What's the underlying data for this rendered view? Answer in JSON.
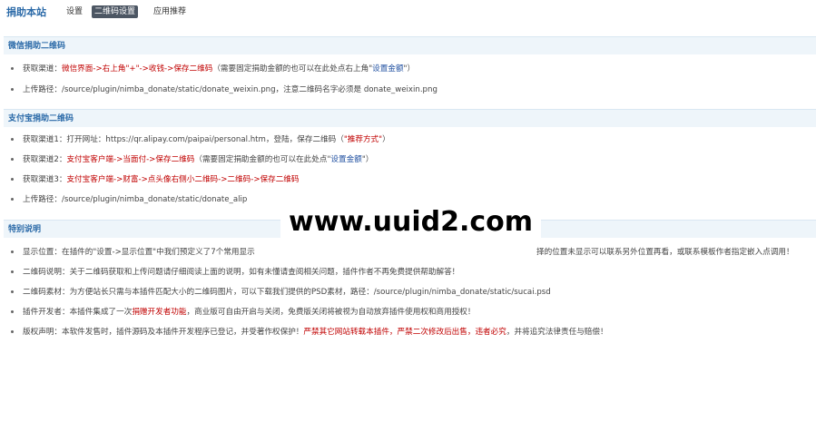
{
  "header": {
    "site_title": "捐助本站",
    "tabs": [
      {
        "label": "设置"
      },
      {
        "label": "二维码设置"
      },
      {
        "label": "应用推荐"
      }
    ]
  },
  "sections": {
    "wechat": {
      "title": "微信捐助二维码",
      "items": [
        {
          "prefix": "获取渠道：",
          "red": "微信界面->右上角\"+\"->收钱->保存二维码",
          "mid": "（需要固定捐助金额的也可以在此处点右上角\"",
          "blue": "设置金额",
          "end": "\"）"
        },
        {
          "text": "上传路径：/source/plugin/nimba_donate/static/donate_weixin.png，注意二维码名字必须是 donate_weixin.png"
        }
      ]
    },
    "alipay": {
      "title": "支付宝捐助二维码",
      "items": [
        {
          "prefix": "获取渠道1：打开网址：https://qr.alipay.com/paipai/personal.htm，登陆，保存二维码（",
          "red": "\"推荐方式\"",
          "end": "）"
        },
        {
          "prefix": "获取渠道2：",
          "red": "支付宝客户端->当面付->保存二维码",
          "mid": "（需要固定捐助金额的也可以在此处点\"",
          "blue": "设置金额",
          "end": "\"）"
        },
        {
          "prefix": "获取渠道3：",
          "red": "支付宝客户端->财富->点头像右侧小二维码->二维码->保存二维码",
          "end": ""
        },
        {
          "text": "上传路径：/source/plugin/nimba_donate/static/donate_alip"
        }
      ]
    },
    "notes": {
      "title": "特别说明",
      "items": [
        {
          "text": "显示位置：在插件的\"设置->显示位置\"中我们预定义了7个常用显示",
          "tail": "择的位置未显示可以联系另外位置再看，或联系模板作者指定嵌入点调用！"
        },
        {
          "text": "二维码说明：关于二维码获取和上传问题请仔细阅读上面的说明，如有未懂请查阅相关问题，插件作者不再免费提供帮助解答！"
        },
        {
          "text": "二维码素材：为方便站长只需与本插件匹配大小的二维码图片，可以下载我们提供的PSD素材，路径：/source/plugin/nimba_donate/static/sucai.psd"
        },
        {
          "prefix": "插件开发者：本插件集成了一次",
          "red": "捐赠开发者功能",
          "end": "，商业版可自由开启与关闭，免费版关闭将被视为自动放弃插件使用权和商用授权！"
        },
        {
          "prefix": "版权声明：本软件发售时，插件源码及本插件开发程序已登记，并受著作权保护！",
          "red": "严禁其它网站转载本插件，严禁二次修改后出售，违者必究",
          "end": "，并将追究法律责任与赔偿！"
        }
      ]
    }
  },
  "watermark": {
    "text": "www.uuid2.com"
  },
  "colors": {
    "title_blue": "#2b6aa8",
    "section_bg": "#eef5fa",
    "active_tab_bg": "#4c5663",
    "emphasis_red": "#c00000",
    "link_blue": "#1f4fa0"
  }
}
